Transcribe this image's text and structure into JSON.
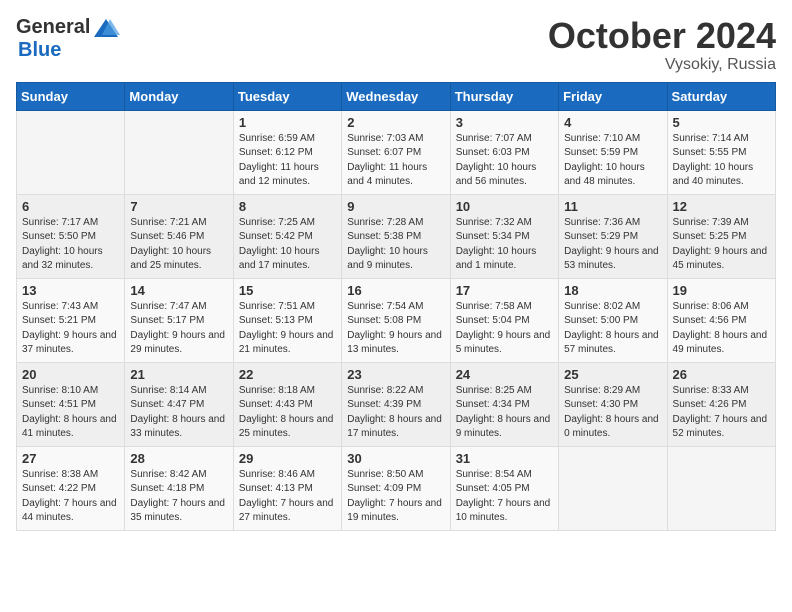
{
  "header": {
    "logo_general": "General",
    "logo_blue": "Blue",
    "month": "October 2024",
    "location": "Vysokiy, Russia"
  },
  "days_of_week": [
    "Sunday",
    "Monday",
    "Tuesday",
    "Wednesday",
    "Thursday",
    "Friday",
    "Saturday"
  ],
  "weeks": [
    [
      {
        "num": "",
        "detail": ""
      },
      {
        "num": "",
        "detail": ""
      },
      {
        "num": "1",
        "detail": "Sunrise: 6:59 AM\nSunset: 6:12 PM\nDaylight: 11 hours\nand 12 minutes."
      },
      {
        "num": "2",
        "detail": "Sunrise: 7:03 AM\nSunset: 6:07 PM\nDaylight: 11 hours\nand 4 minutes."
      },
      {
        "num": "3",
        "detail": "Sunrise: 7:07 AM\nSunset: 6:03 PM\nDaylight: 10 hours\nand 56 minutes."
      },
      {
        "num": "4",
        "detail": "Sunrise: 7:10 AM\nSunset: 5:59 PM\nDaylight: 10 hours\nand 48 minutes."
      },
      {
        "num": "5",
        "detail": "Sunrise: 7:14 AM\nSunset: 5:55 PM\nDaylight: 10 hours\nand 40 minutes."
      }
    ],
    [
      {
        "num": "6",
        "detail": "Sunrise: 7:17 AM\nSunset: 5:50 PM\nDaylight: 10 hours\nand 32 minutes."
      },
      {
        "num": "7",
        "detail": "Sunrise: 7:21 AM\nSunset: 5:46 PM\nDaylight: 10 hours\nand 25 minutes."
      },
      {
        "num": "8",
        "detail": "Sunrise: 7:25 AM\nSunset: 5:42 PM\nDaylight: 10 hours\nand 17 minutes."
      },
      {
        "num": "9",
        "detail": "Sunrise: 7:28 AM\nSunset: 5:38 PM\nDaylight: 10 hours\nand 9 minutes."
      },
      {
        "num": "10",
        "detail": "Sunrise: 7:32 AM\nSunset: 5:34 PM\nDaylight: 10 hours\nand 1 minute."
      },
      {
        "num": "11",
        "detail": "Sunrise: 7:36 AM\nSunset: 5:29 PM\nDaylight: 9 hours\nand 53 minutes."
      },
      {
        "num": "12",
        "detail": "Sunrise: 7:39 AM\nSunset: 5:25 PM\nDaylight: 9 hours\nand 45 minutes."
      }
    ],
    [
      {
        "num": "13",
        "detail": "Sunrise: 7:43 AM\nSunset: 5:21 PM\nDaylight: 9 hours\nand 37 minutes."
      },
      {
        "num": "14",
        "detail": "Sunrise: 7:47 AM\nSunset: 5:17 PM\nDaylight: 9 hours\nand 29 minutes."
      },
      {
        "num": "15",
        "detail": "Sunrise: 7:51 AM\nSunset: 5:13 PM\nDaylight: 9 hours\nand 21 minutes."
      },
      {
        "num": "16",
        "detail": "Sunrise: 7:54 AM\nSunset: 5:08 PM\nDaylight: 9 hours\nand 13 minutes."
      },
      {
        "num": "17",
        "detail": "Sunrise: 7:58 AM\nSunset: 5:04 PM\nDaylight: 9 hours\nand 5 minutes."
      },
      {
        "num": "18",
        "detail": "Sunrise: 8:02 AM\nSunset: 5:00 PM\nDaylight: 8 hours\nand 57 minutes."
      },
      {
        "num": "19",
        "detail": "Sunrise: 8:06 AM\nSunset: 4:56 PM\nDaylight: 8 hours\nand 49 minutes."
      }
    ],
    [
      {
        "num": "20",
        "detail": "Sunrise: 8:10 AM\nSunset: 4:51 PM\nDaylight: 8 hours\nand 41 minutes."
      },
      {
        "num": "21",
        "detail": "Sunrise: 8:14 AM\nSunset: 4:47 PM\nDaylight: 8 hours\nand 33 minutes."
      },
      {
        "num": "22",
        "detail": "Sunrise: 8:18 AM\nSunset: 4:43 PM\nDaylight: 8 hours\nand 25 minutes."
      },
      {
        "num": "23",
        "detail": "Sunrise: 8:22 AM\nSunset: 4:39 PM\nDaylight: 8 hours\nand 17 minutes."
      },
      {
        "num": "24",
        "detail": "Sunrise: 8:25 AM\nSunset: 4:34 PM\nDaylight: 8 hours\nand 9 minutes."
      },
      {
        "num": "25",
        "detail": "Sunrise: 8:29 AM\nSunset: 4:30 PM\nDaylight: 8 hours\nand 0 minutes."
      },
      {
        "num": "26",
        "detail": "Sunrise: 8:33 AM\nSunset: 4:26 PM\nDaylight: 7 hours\nand 52 minutes."
      }
    ],
    [
      {
        "num": "27",
        "detail": "Sunrise: 8:38 AM\nSunset: 4:22 PM\nDaylight: 7 hours\nand 44 minutes."
      },
      {
        "num": "28",
        "detail": "Sunrise: 8:42 AM\nSunset: 4:18 PM\nDaylight: 7 hours\nand 35 minutes."
      },
      {
        "num": "29",
        "detail": "Sunrise: 8:46 AM\nSunset: 4:13 PM\nDaylight: 7 hours\nand 27 minutes."
      },
      {
        "num": "30",
        "detail": "Sunrise: 8:50 AM\nSunset: 4:09 PM\nDaylight: 7 hours\nand 19 minutes."
      },
      {
        "num": "31",
        "detail": "Sunrise: 8:54 AM\nSunset: 4:05 PM\nDaylight: 7 hours\nand 10 minutes."
      },
      {
        "num": "",
        "detail": ""
      },
      {
        "num": "",
        "detail": ""
      }
    ]
  ]
}
